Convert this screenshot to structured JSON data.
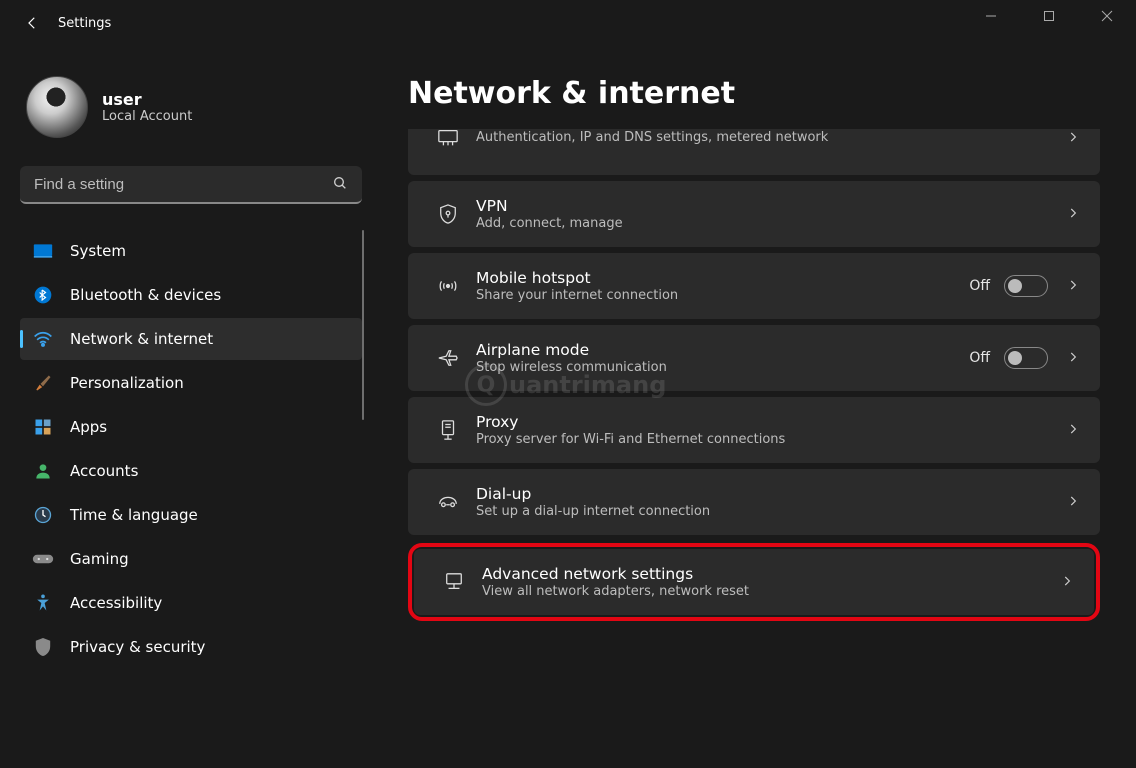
{
  "titlebar": {
    "title": "Settings"
  },
  "profile": {
    "username": "user",
    "account_type": "Local Account"
  },
  "search": {
    "placeholder": "Find a setting"
  },
  "nav": {
    "items": [
      {
        "label": "System"
      },
      {
        "label": "Bluetooth & devices"
      },
      {
        "label": "Network & internet"
      },
      {
        "label": "Personalization"
      },
      {
        "label": "Apps"
      },
      {
        "label": "Accounts"
      },
      {
        "label": "Time & language"
      },
      {
        "label": "Gaming"
      },
      {
        "label": "Accessibility"
      },
      {
        "label": "Privacy & security"
      }
    ],
    "active_index": 2
  },
  "page": {
    "title": "Network & internet"
  },
  "cards": {
    "ethernet_sub": "Authentication, IP and DNS settings, metered network",
    "vpn": {
      "title": "VPN",
      "sub": "Add, connect, manage"
    },
    "hotspot": {
      "title": "Mobile hotspot",
      "sub": "Share your internet connection",
      "toggle": "Off"
    },
    "airplane": {
      "title": "Airplane mode",
      "sub": "Stop wireless communication",
      "toggle": "Off"
    },
    "proxy": {
      "title": "Proxy",
      "sub": "Proxy server for Wi-Fi and Ethernet connections"
    },
    "dialup": {
      "title": "Dial-up",
      "sub": "Set up a dial-up internet connection"
    },
    "advanced": {
      "title": "Advanced network settings",
      "sub": "View all network adapters, network reset"
    }
  },
  "watermark": "uantrimang"
}
